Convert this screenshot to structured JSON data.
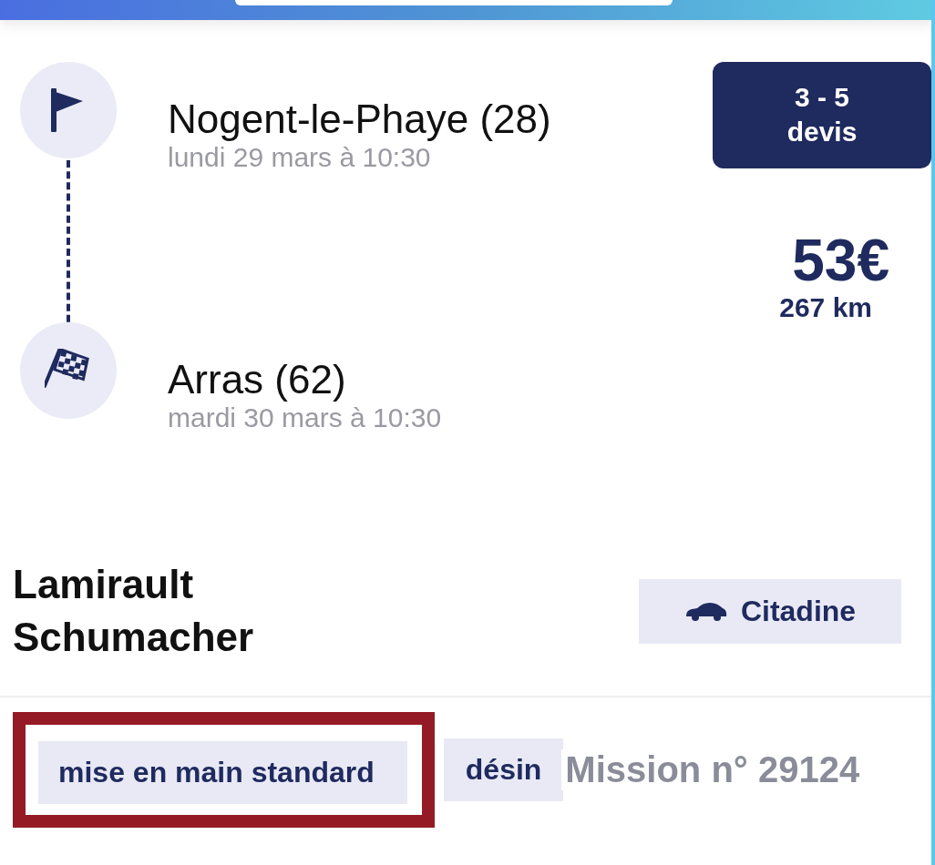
{
  "route": {
    "stops": [
      {
        "kind": "start",
        "city": "Nogent-le-Phaye (28)",
        "date": "lundi 29 mars à 10:30"
      },
      {
        "kind": "finish",
        "city": "Arras (62)",
        "date": "mardi 30 mars à 10:30"
      }
    ]
  },
  "quotes_badge": {
    "line_1": "3 - 5",
    "line_2": "devis"
  },
  "price": "53€",
  "distance": "267 km",
  "client": {
    "name_line_1": "Lamirault",
    "name_line_2": "Schumacher"
  },
  "vehicle_tag": "Citadine",
  "tags": [
    {
      "label": "mise en main standard",
      "highlighted": true
    },
    {
      "label": "désin",
      "highlighted": false
    }
  ],
  "mission": "Mission n° 29124"
}
